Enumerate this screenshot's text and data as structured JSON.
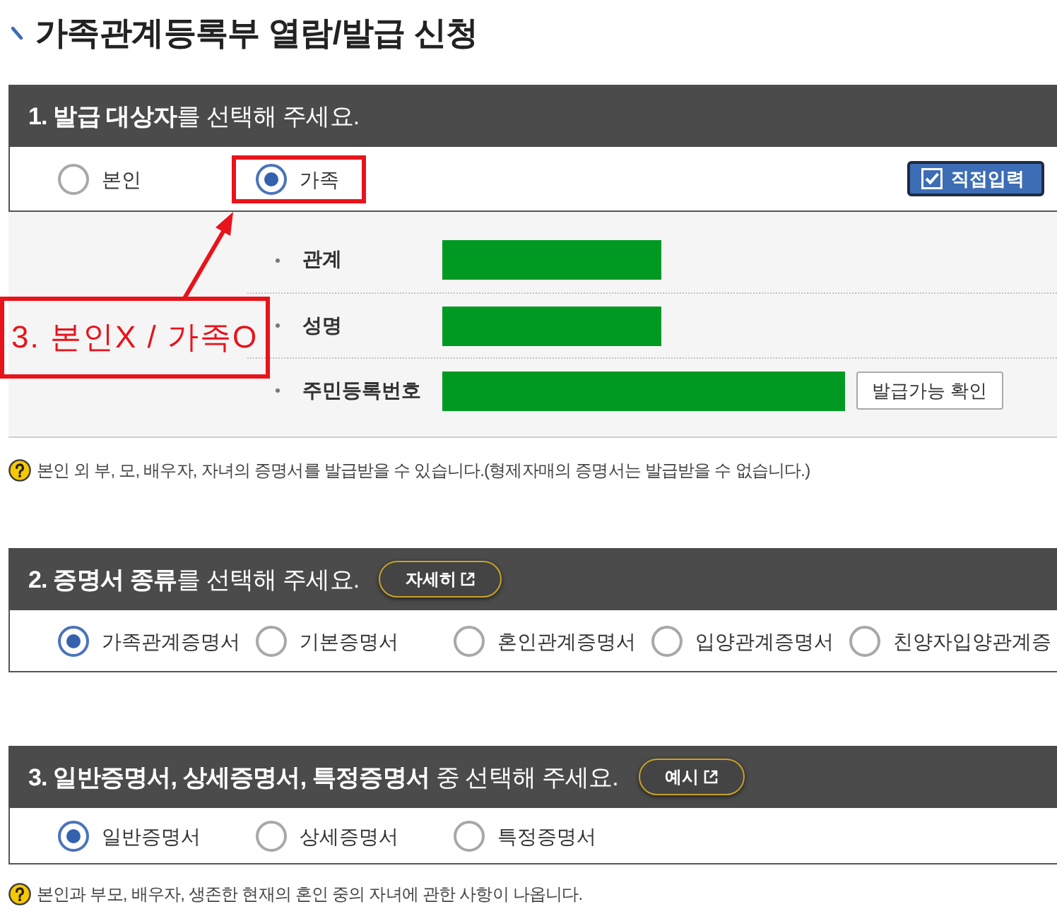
{
  "page": {
    "title": "가족관계등록부 열람/발급 신청"
  },
  "step_1": {
    "heading": "**1. 발급 대상자**를 선택해 주세요.",
    "options": [
      {
        "label": "본인",
        "selected": false,
        "highlighted": false
      },
      {
        "label": "가족",
        "selected": true,
        "highlighted": true
      }
    ],
    "direct_input_button": "직접입력",
    "fields": [
      {
        "label": "관계",
        "kind": "single",
        "redacted": true
      },
      {
        "label": "성명",
        "kind": "single",
        "redacted": true
      },
      {
        "label": "주민등록번호",
        "kind": "split",
        "redacted": true,
        "button": "발급가능 확인"
      }
    ],
    "note": "본인 외 부, 모, 배우자, 자녀의 증명서를 발급받을 수 있습니다.(형제자매의 증명서는 발급받을 수 없습니다.)"
  },
  "annotation": {
    "text": "3. 본인X / 가족O"
  },
  "step_2": {
    "heading": "**2. 증명서 종류**를 선택해 주세요.",
    "link_button": "자세히",
    "options": [
      {
        "label": "가족관계증명서",
        "selected": true
      },
      {
        "label": "기본증명서",
        "selected": false
      },
      {
        "label": "혼인관계증명서",
        "selected": false
      },
      {
        "label": "입양관계증명서",
        "selected": false
      },
      {
        "label": "친양자입양관계증",
        "selected": false
      }
    ]
  },
  "step_3": {
    "heading": "**3. 일반증명서, 상세증명서, 특정증명서** 중 선택해 주세요.",
    "link_button": "예시",
    "options": [
      {
        "label": "일반증명서",
        "selected": true
      },
      {
        "label": "상세증명서",
        "selected": false
      },
      {
        "label": "특정증명서",
        "selected": false
      }
    ],
    "note": "본인과 부모, 배우자, 생존한 현재의 혼인 중의 자녀에 관한 사항이 나옵니다."
  }
}
